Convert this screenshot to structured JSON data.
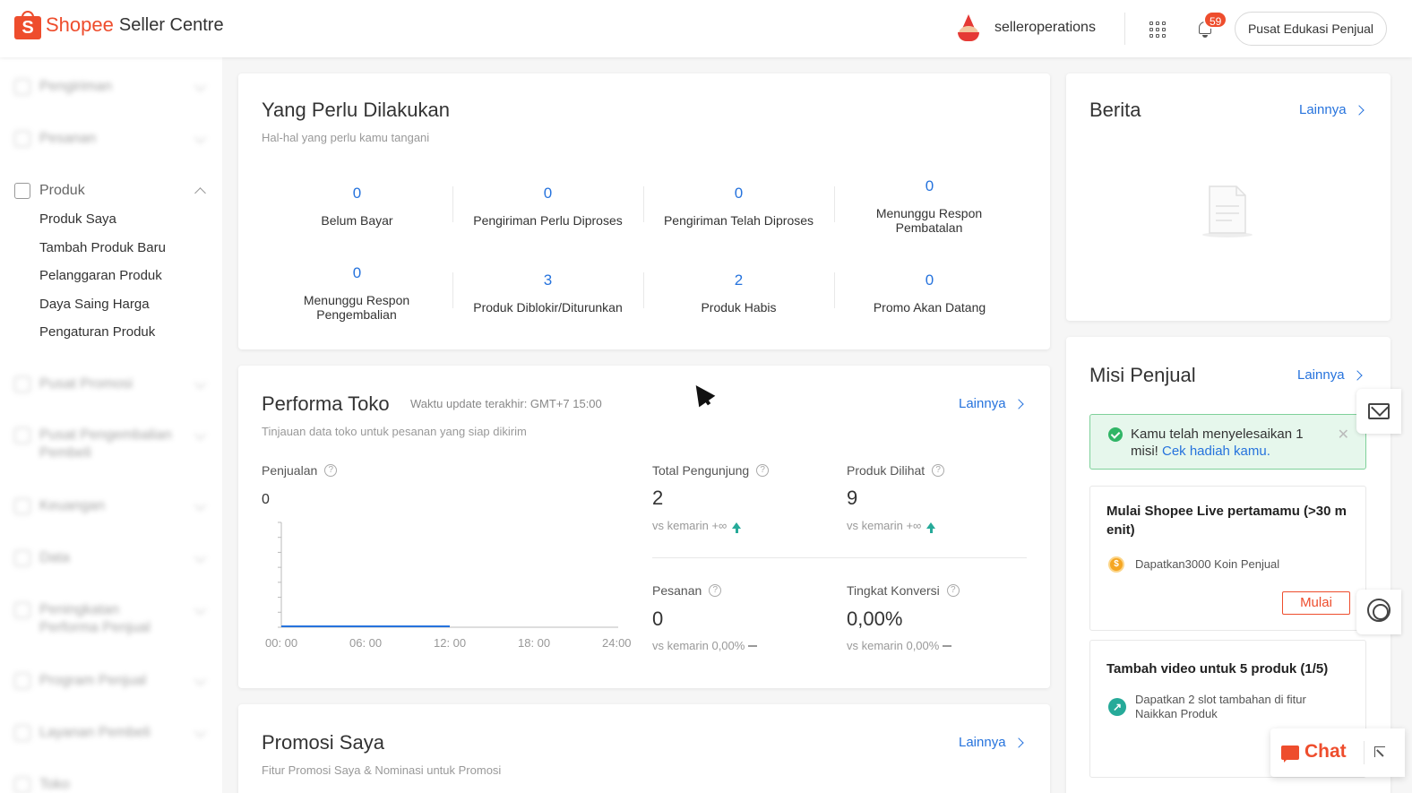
{
  "header": {
    "logo_brand": "Shopee",
    "logo_sub": "Seller Centre",
    "logo_letter": "S",
    "username": "selleroperations",
    "notification_count": "59",
    "edu_button": "Pusat Edukasi Penjual"
  },
  "sidebar": {
    "blurred_sections": [
      "Pengiriman",
      "Pesanan",
      "Pusat Promosi",
      "Pusat Pengembalian Pembeli",
      "Keuangan",
      "Data",
      "Peningkatan Performa Penjual",
      "Program Penjual",
      "Layanan Pembeli",
      "Toko"
    ],
    "produk": {
      "label": "Produk",
      "items": [
        "Produk Saya",
        "Tambah Produk Baru",
        "Pelanggaran Produk",
        "Daya Saing Harga",
        "Pengaturan Produk"
      ]
    }
  },
  "todo": {
    "title": "Yang Perlu Dilakukan",
    "subtitle": "Hal-hal yang perlu kamu tangani",
    "items": [
      {
        "value": "0",
        "label": "Belum Bayar"
      },
      {
        "value": "0",
        "label": "Pengiriman Perlu Diproses"
      },
      {
        "value": "0",
        "label": "Pengiriman Telah Diproses"
      },
      {
        "value": "0",
        "label": "Menunggu Respon Pembatalan"
      },
      {
        "value": "0",
        "label": "Menunggu Respon Pengembalian"
      },
      {
        "value": "3",
        "label": "Produk Diblokir/Diturunkan"
      },
      {
        "value": "2",
        "label": "Produk Habis"
      },
      {
        "value": "0",
        "label": "Promo Akan Datang"
      }
    ]
  },
  "performance": {
    "title": "Performa Toko",
    "update": "Waktu update terakhir: GMT+7 15:00",
    "more": "Lainnya",
    "subtitle": "Tinjauan data toko untuk pesanan yang siap dikirim",
    "sales_label": "Penjualan",
    "sales_value": "0",
    "ticks": [
      "00: 00",
      "06: 00",
      "12: 00",
      "18: 00",
      "24:00"
    ],
    "metrics": [
      {
        "label": "Total Pengunjung",
        "value": "2",
        "vs": "vs kemarin +∞"
      },
      {
        "label": "Produk Dilihat",
        "value": "9",
        "vs": "vs kemarin +∞"
      },
      {
        "label": "Pesanan",
        "value": "0",
        "vs": "vs kemarin 0,00%"
      },
      {
        "label": "Tingkat Konversi",
        "value": "0,00%",
        "vs": "vs kemarin 0,00%"
      }
    ]
  },
  "chart_data": {
    "type": "line",
    "x": [
      "00: 00",
      "06: 00",
      "12: 00",
      "18: 00",
      "24:00"
    ],
    "series": [
      {
        "values": [
          0,
          0,
          0
        ]
      }
    ],
    "title": "Penjualan",
    "xlabel": "",
    "ylabel": "",
    "grid": false
  },
  "promo": {
    "title": "Promosi Saya",
    "more": "Lainnya",
    "subtitle": "Fitur Promosi Saya & Nominasi untuk Promosi"
  },
  "news": {
    "title": "Berita",
    "more": "Lainnya"
  },
  "missions": {
    "title": "Misi Penjual",
    "more": "Lainnya",
    "notice_text": "Kamu telah menyelesaikan 1 misi! ",
    "notice_link": "Cek hadiah kamu.",
    "items": [
      {
        "title": "Mulai Shopee Live pertamamu (>30 m enit)",
        "reward": "Dapatkan3000 Koin Penjual",
        "button": "Mulai"
      },
      {
        "title": "Tambah video untuk 5 produk (1/5)",
        "reward": "Dapatkan 2 slot tambahan di fitur Naikkan Produk"
      }
    ]
  },
  "chat": {
    "label": "Chat"
  },
  "colors": {
    "brand": "#ee4d2d",
    "link": "#2673dd",
    "success": "#30b566"
  }
}
